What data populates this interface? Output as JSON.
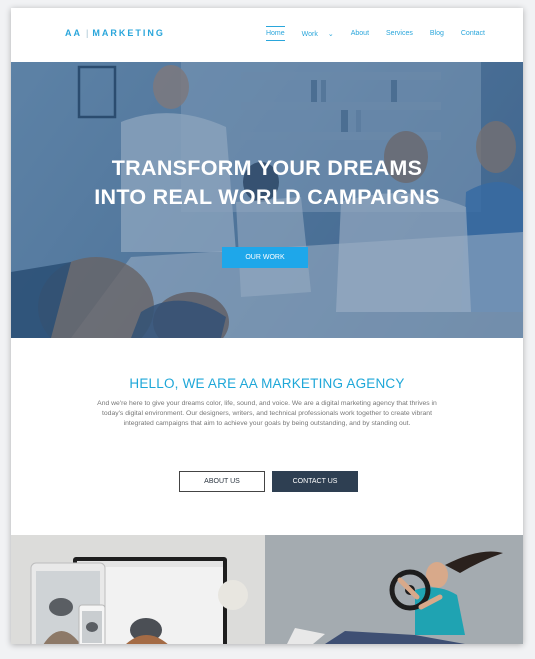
{
  "header": {
    "logo_left": "AA",
    "logo_sep": "|",
    "logo_right": "MARKETING",
    "nav": [
      "Home",
      "Work",
      "About",
      "Services",
      "Blog",
      "Contact"
    ]
  },
  "hero": {
    "title_line1": "TRANSFORM YOUR DREAMS",
    "title_line2": "INTO REAL WORLD CAMPAIGNS",
    "button": "OUR WORK"
  },
  "intro": {
    "heading": "HELLO, WE ARE AA MARKETING AGENCY",
    "body": "And we're here to give your dreams color, life, sound, and voice. We are a digital marketing agency that thrives in today's digital environment. Our designers, writers, and technical professionals work together to create vibrant integrated campaigns that aim to achieve your goals by being outstanding, and by standing out.",
    "about_button": "ABOUT US",
    "contact_button": "CONTACT US"
  },
  "colors": {
    "accent": "#1ea7ea",
    "dark_button": "#2e3f52",
    "hero_tint": "#4b6f92"
  },
  "icons": {
    "work_dropdown": "chevron-down-icon"
  }
}
